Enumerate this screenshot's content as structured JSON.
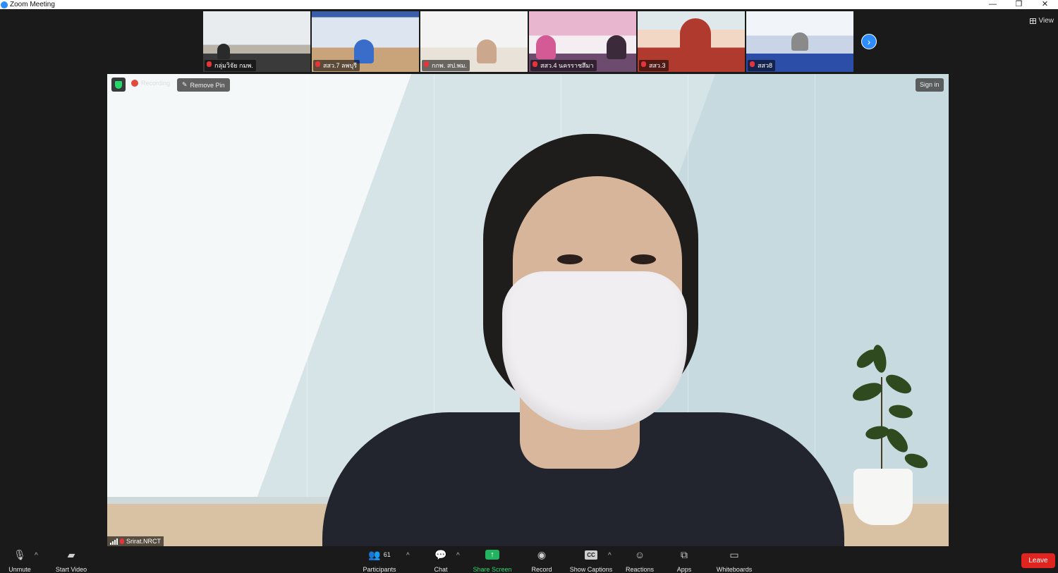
{
  "window": {
    "title": "Zoom Meeting",
    "controls": [
      "—",
      "❐",
      "✕"
    ]
  },
  "view_button": {
    "label": "View"
  },
  "participants_strip": [
    {
      "name": "กลุ่มวิจัย กมพ."
    },
    {
      "name": "สสว.7 ลพบุรี"
    },
    {
      "name": "กกพ. สป.พม."
    },
    {
      "name": "สสว.4 นครราชสีมา"
    },
    {
      "name": "สสว.3"
    },
    {
      "name": "สสว8"
    }
  ],
  "next_page_icon": "chevron-right-icon",
  "meeting_overlay": {
    "recording_label": "Recording",
    "remove_pin_label": "Remove Pin",
    "sign_in_label": "Sign in"
  },
  "active_speaker": {
    "name": "Srirat.NRCT"
  },
  "toolbar": {
    "unmute": "Unmute",
    "start_video": "Start Video",
    "participants": "Participants",
    "participant_count": "61",
    "chat": "Chat",
    "share_screen": "Share Screen",
    "record": "Record",
    "show_captions": "Show Captions",
    "captions_badge": "CC",
    "reactions": "Reactions",
    "apps": "Apps",
    "whiteboards": "Whiteboards",
    "leave": "Leave"
  },
  "colors": {
    "accent_blue": "#2d8cff",
    "leave_red": "#e0241f",
    "share_green": "#23b360",
    "muted_red": "#e5343a"
  }
}
